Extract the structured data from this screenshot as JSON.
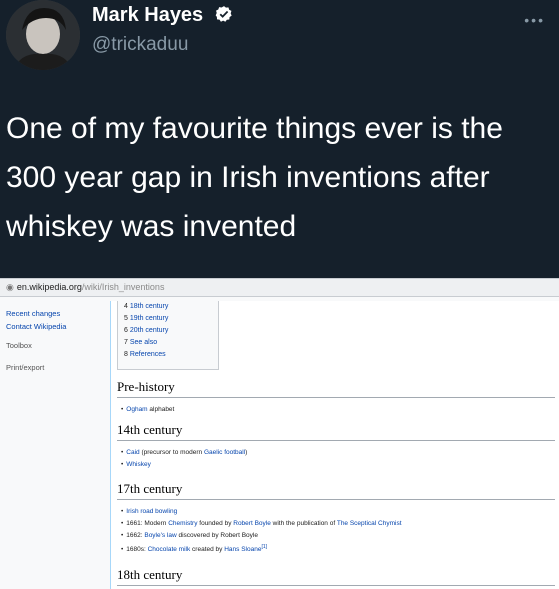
{
  "tweet": {
    "display_name": "Mark Hayes",
    "handle": "@trickaduu",
    "more_label": "•••",
    "text": "One of my favourite things ever is the 300 year gap in Irish inventions after whiskey was invented",
    "colors": {
      "background": "#15202b",
      "text": "#ffffff",
      "secondary": "#8899a6",
      "verified": "#ffffff"
    }
  },
  "screenshot": {
    "url_domain": "en.wikipedia.org",
    "url_path": "/wiki/Irish_inventions",
    "sidebar": [
      "Recent changes",
      "Contact Wikipedia",
      "Toolbox",
      "Print/export"
    ],
    "toc": [
      {
        "num": "4",
        "label": "18th century"
      },
      {
        "num": "5",
        "label": "19th century"
      },
      {
        "num": "6",
        "label": "20th century"
      },
      {
        "num": "7",
        "label": "See also"
      },
      {
        "num": "8",
        "label": "References"
      }
    ],
    "sections": {
      "prehistory": {
        "title": "Pre-history",
        "items": [
          {
            "link": "Ogham",
            "rest": " alphabet"
          }
        ]
      },
      "c14": {
        "title": "14th century",
        "items": [
          {
            "link": "Caid",
            "rest": " (precursor to modern ",
            "link2": "Gaelic football",
            "rest2": ")"
          },
          {
            "link": "Whiskey",
            "rest": ""
          }
        ]
      },
      "c17": {
        "title": "17th century",
        "items": [
          {
            "pre": "",
            "link": "Irish road bowling",
            "rest": ""
          },
          {
            "pre": "1661: Modern ",
            "link": "Chemistry",
            "rest": " founded by ",
            "link2": "Robert Boyle",
            "rest2": " with the publication of ",
            "link3": "The Sceptical Chymist",
            "rest3": ""
          },
          {
            "pre": "1662: ",
            "link": "Boyle's law",
            "rest": " discovered by Robert Boyle"
          },
          {
            "pre": "1680s: ",
            "link": "Chocolate milk",
            "rest": " created by ",
            "link2": "Hans Sloane",
            "rest2": "",
            "sup": "[1]"
          }
        ]
      },
      "c18": {
        "title": "18th century"
      }
    }
  }
}
